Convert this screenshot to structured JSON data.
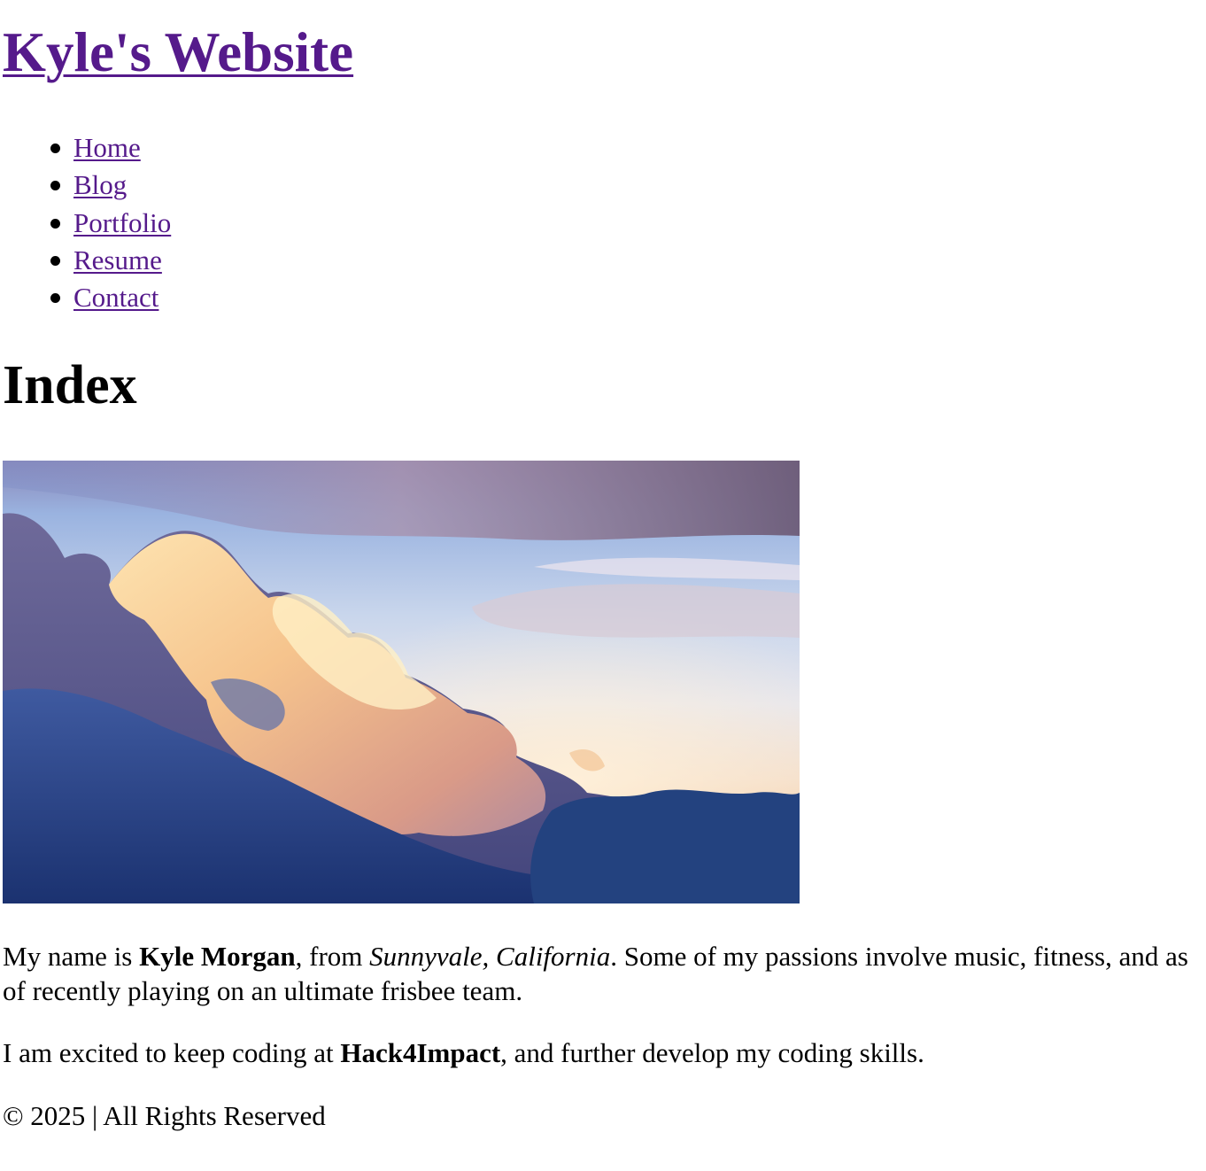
{
  "header": {
    "site_title": "Kyle's Website"
  },
  "nav": {
    "items": [
      {
        "label": "Home"
      },
      {
        "label": "Blog"
      },
      {
        "label": "Portfolio"
      },
      {
        "label": "Resume"
      },
      {
        "label": "Contact"
      }
    ]
  },
  "main": {
    "heading": "Index",
    "intro": {
      "part1": "My name is ",
      "name": "Kyle Morgan",
      "part2": ", from ",
      "location": "Sunnyvale, California",
      "part3": ". Some of my passions involve music, fitness, and as of recently playing on an ultimate frisbee team."
    },
    "second": {
      "part1": "I am excited to keep coding at ",
      "org": "Hack4Impact",
      "part2": ", and further develop my coding skills."
    }
  },
  "footer": {
    "text": "© 2025 | All Rights Reserved"
  },
  "colors": {
    "link": "#551a8b",
    "text": "#000000",
    "background": "#ffffff"
  }
}
